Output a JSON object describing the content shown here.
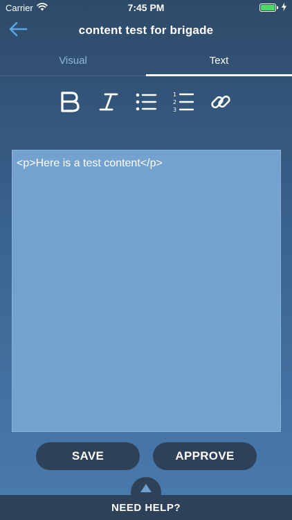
{
  "status_bar": {
    "carrier": "Carrier",
    "time": "7:45 PM",
    "battery_level": 1.0,
    "wifi_icon": "wifi-icon",
    "battery_icon": "battery-icon",
    "charging_icon": "bolt-icon"
  },
  "nav": {
    "title": "content test for brigade",
    "back_icon": "arrow-left-icon"
  },
  "tabs": [
    {
      "label": "Visual",
      "selected": false
    },
    {
      "label": "Text",
      "selected": true
    }
  ],
  "toolbar": {
    "bold_icon": "bold-icon",
    "italic_icon": "italic-icon",
    "bullet_list_icon": "bullet-list-icon",
    "numbered_list_icon": "numbered-list-icon",
    "link_icon": "link-icon"
  },
  "editor": {
    "content": "<p>Here is a test content</p>"
  },
  "actions": {
    "save_label": "SAVE",
    "approve_label": "APPROVE"
  },
  "help": {
    "label": "NEED HELP?",
    "icon": "caret-up-icon"
  },
  "colors": {
    "accent_blue": "#74a2cf",
    "button_dark": "#2d4158",
    "tab_inactive": "#8fb8e0",
    "battery_green": "#4cd964"
  }
}
